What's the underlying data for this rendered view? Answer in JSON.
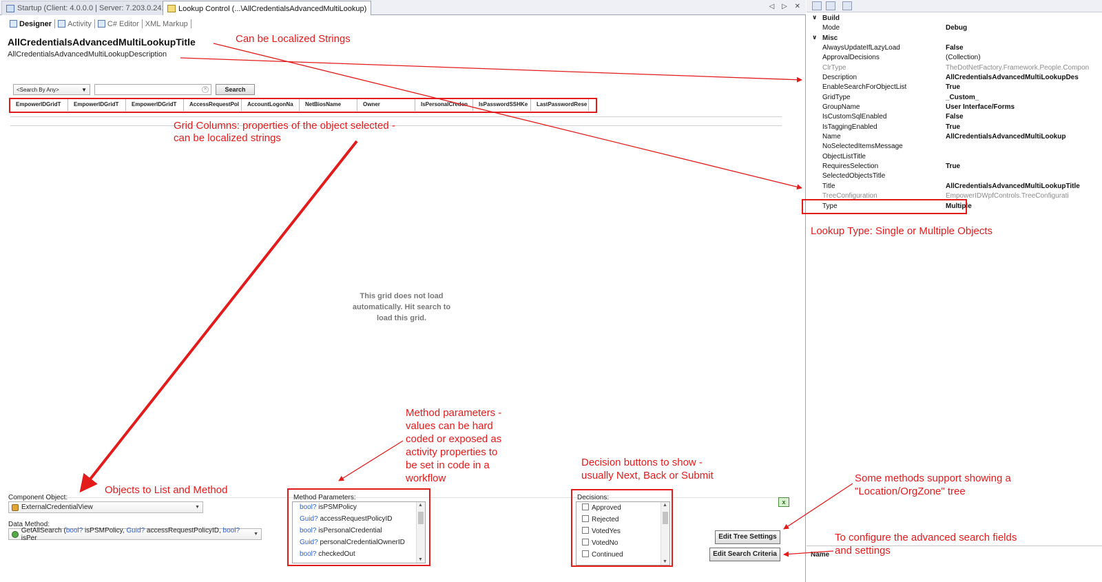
{
  "tabs": [
    {
      "label": "Startup (Client: 4.0.0.0 | Server: 7.203.0.24194)",
      "active": false,
      "icon": "window-icon"
    },
    {
      "label": "Lookup  Control  (...\\AllCredentialsAdvancedMultiLookup)",
      "active": true,
      "icon": "lookup-control-icon"
    }
  ],
  "tab_controls": "◁ ▷ ✕",
  "designer": {
    "subtabs": [
      "Designer",
      "Activity",
      "C# Editor",
      "XML Markup"
    ],
    "title": "AllCredentialsAdvancedMultiLookupTitle",
    "description": "AllCredentialsAdvancedMultiLookupDescription",
    "search_by": "<Search By Any>",
    "search_value": "",
    "search_button": "Search",
    "grid_columns": [
      "EmpowerIDGridT",
      "EmpowerIDGridT",
      "EmpowerIDGridT",
      "AccessRequestPol",
      "AccountLogonNa",
      "NetBiosName",
      "Owner",
      "IsPersonalCreden",
      "IsPasswordSSHKe",
      "LastPasswordRese"
    ],
    "grid_empty_line1": "This grid does not load",
    "grid_empty_line2": "automatically. Hit search to",
    "grid_empty_line3": "load this grid.",
    "component_object_label": "Component Object:",
    "component_object_value": "ExternalCredentialView",
    "data_method_label": "Data Method:",
    "data_method_parts": [
      "GetAllSearch (",
      "bool?",
      " isPSMPolicy, ",
      "Guid?",
      " accessRequestPolicyID, ",
      "bool?",
      " isPer"
    ],
    "method_parameters_label": "Method Parameters:",
    "method_parameters": [
      {
        "type": "bool?",
        "name": "isPSMPolicy"
      },
      {
        "type": "Guid?",
        "name": "accessRequestPolicyID"
      },
      {
        "type": "bool?",
        "name": "isPersonalCredential"
      },
      {
        "type": "Guid?",
        "name": "personalCredentialOwnerID"
      },
      {
        "type": "bool?",
        "name": "checkedOut"
      }
    ],
    "decisions_label": "Decisions:",
    "decisions": [
      {
        "label": "Approved",
        "checked": false
      },
      {
        "label": "Rejected",
        "checked": false
      },
      {
        "label": "VotedYes",
        "checked": false
      },
      {
        "label": "VotedNo",
        "checked": false
      },
      {
        "label": "Continued",
        "checked": false
      }
    ],
    "edit_tree_button": "Edit Tree Settings",
    "edit_search_button": "Edit Search Criteria"
  },
  "properties": {
    "categories": [
      "Build",
      "Misc"
    ],
    "build": [
      {
        "name": "Mode",
        "value": "Debug"
      }
    ],
    "misc": [
      {
        "name": "AlwaysUpdateIfLazyLoad",
        "value": "False"
      },
      {
        "name": "ApprovalDecisions",
        "value": "(Collection)",
        "bold": false
      },
      {
        "name": "ClrType",
        "value": "TheDotNetFactory.Framework.People.Compon",
        "dim": true
      },
      {
        "name": "Description",
        "value": "AllCredentialsAdvancedMultiLookupDes"
      },
      {
        "name": "EnableSearchForObjectList",
        "value": "True"
      },
      {
        "name": "GridType",
        "value": "_Custom_"
      },
      {
        "name": "GroupName",
        "value": "User Interface/Forms"
      },
      {
        "name": "IsCustomSqlEnabled",
        "value": "False"
      },
      {
        "name": "IsTaggingEnabled",
        "value": "True"
      },
      {
        "name": "Name",
        "value": "AllCredentialsAdvancedMultiLookup"
      },
      {
        "name": "NoSelectedItemsMessage",
        "value": ""
      },
      {
        "name": "ObjectListTitle",
        "value": ""
      },
      {
        "name": "RequiresSelection",
        "value": "True"
      },
      {
        "name": "SelectedObjectsTitle",
        "value": ""
      },
      {
        "name": "Title",
        "value": "AllCredentialsAdvancedMultiLookupTitle"
      },
      {
        "name": "TreeConfiguration",
        "value": "EmpowerIDWpfControls.TreeConfigurati",
        "dim": true
      },
      {
        "name": "Type",
        "value": "Multiple"
      }
    ],
    "description_name": "Name"
  },
  "annotations": {
    "localized": "Can be Localized Strings",
    "grid_columns_1": "Grid Columns: properties of the object selected -",
    "grid_columns_2": "can be localized strings",
    "lookup_type": "Lookup Type: Single or Multiple Objects",
    "objects_to_list": "Objects to List and Method",
    "method_params": [
      "Method parameters -",
      "values can be hard",
      "coded or exposed as",
      "activity properties to",
      "be set in code in a",
      "workflow"
    ],
    "decision_buttons": [
      "Decision buttons to show -",
      "usually Next, Back or Submit"
    ],
    "tree_methods": [
      "Some methods support showing a",
      "\"Location/OrgZone\" tree"
    ],
    "search_fields": [
      "To configure the advanced search fields",
      "and settings"
    ]
  },
  "colors": {
    "annotation": "#e31b1b",
    "keyword": "#2b5fd0"
  }
}
